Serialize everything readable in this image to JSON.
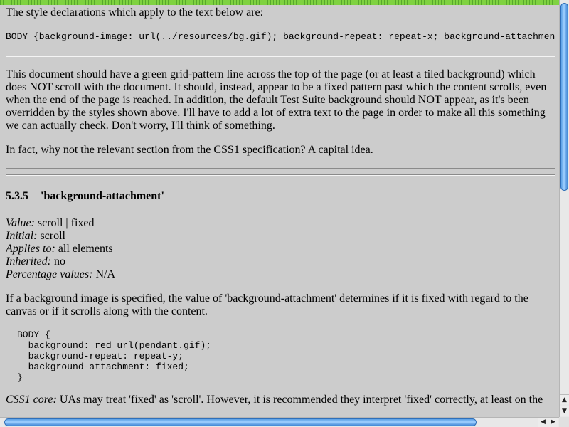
{
  "intro": "The style declarations which apply to the text below are:",
  "declarations": "BODY {background-image: url(../resources/bg.gif); background-repeat: repeat-x; background-attachment: fixed;}",
  "para1": "This document should have a green grid-pattern line across the top of the page (or at least a tiled background) which does NOT scroll with the document. It should, instead, appear to be a fixed pattern past which the content scrolls, even when the end of the page is reached. In addition, the default Test Suite background should NOT appear, as it's been overridden by the styles shown above. I'll have to add a lot of extra text to the page in order to make all this something we can actually check. Don't worry, I'll think of something.",
  "para2": "In fact, why not the relevant section from the CSS1 specification? A capital idea.",
  "section": {
    "number": "5.3.5",
    "title": "'background-attachment'"
  },
  "definitions": [
    {
      "term": "Value:",
      "value": "scroll | fixed"
    },
    {
      "term": "Initial:",
      "value": "scroll"
    },
    {
      "term": "Applies to:",
      "value": "all elements"
    },
    {
      "term": "Inherited:",
      "value": "no"
    },
    {
      "term": "Percentage values:",
      "value": "N/A"
    }
  ],
  "para3": "If a background image is specified, the value of 'background-attachment' determines if it is fixed with regard to the canvas or if it scrolls along with the content.",
  "code": "BODY {\n  background: red url(pendant.gif);\n  background-repeat: repeat-y;\n  background-attachment: fixed;\n}",
  "para4": {
    "label": "CSS1 core:",
    "text": " UAs may treat 'fixed' as 'scroll'. However, it is recommended they interpret 'fixed' correctly, at least on the"
  },
  "scrollbar": {
    "up_arrow": "▲",
    "down_arrow": "▼",
    "left_arrow": "◀",
    "right_arrow": "▶",
    "vertical_position": 0.0,
    "horizontal_position": 0.0
  },
  "colors": {
    "page_bg": "#cccccc",
    "top_strip": "#7fd241",
    "scroll_thumb": "#5aa0e6"
  }
}
